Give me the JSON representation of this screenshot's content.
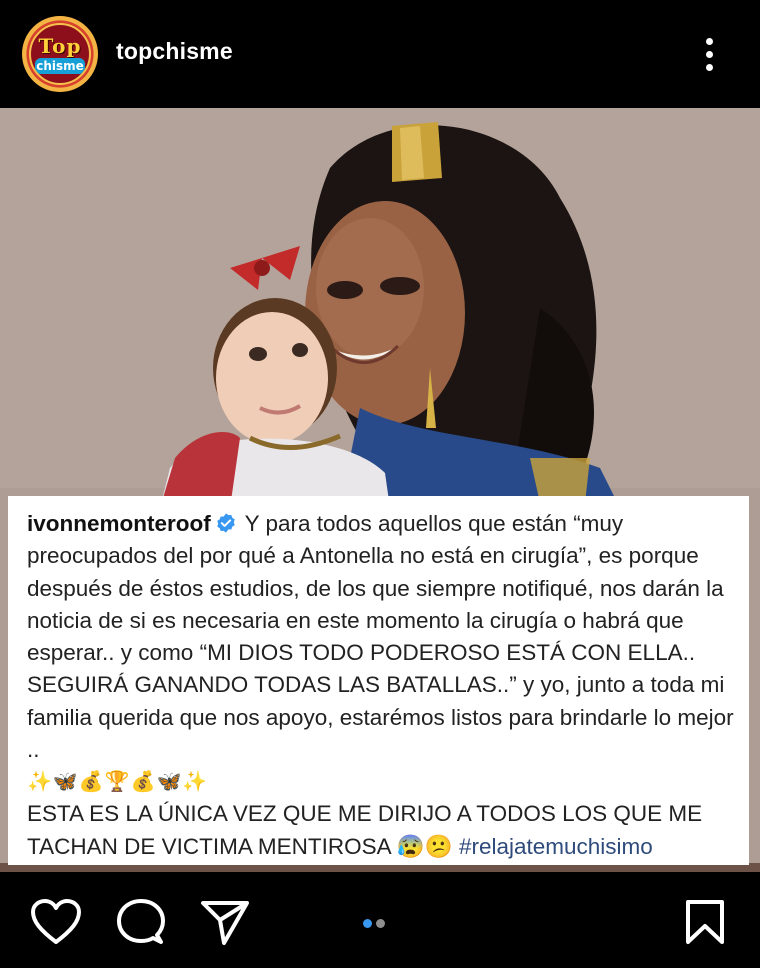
{
  "header": {
    "logo": {
      "top": "Top",
      "bottom": "chisme"
    },
    "username": "topchisme"
  },
  "caption": {
    "username": "ivonnemonteroof",
    "text": "Y para todos aquellos que están “muy preocupados del por qué a Antonella no está en cirugía”, es porque después de éstos estudios, de los que siempre notifiqué, nos darán la noticia de si es necesaria en este momento la cirugía o habrá que esperar.. y como “MI DIOS TODO PODEROSO ESTÁ CON ELLA.. SEGUIRÁ GANANDO TODAS LAS BATALLAS..” y yo, junto a toda mi familia querida que nos apoyo, estarémos listos para brindarle lo mejor ..",
    "emoji_line": "✨🦋💰🏆💰🦋✨",
    "closing_text": "ESTA ES LA ÚNICA VEZ QUE ME DIRIJO A TODOS LOS QUE ME TACHAN DE VICTIMA MENTIROSA",
    "closing_emoji": "😰😕",
    "hashtag": "#relajatemuchisimo"
  },
  "actions": {
    "icons": [
      "heart-icon",
      "comment-icon",
      "share-icon",
      "bookmark-icon"
    ],
    "carousel": {
      "pages": 2,
      "current": 1
    }
  },
  "colors": {
    "background": "#000000",
    "carousel_active": "#3897f0",
    "carousel_inactive": "#8e8e8e",
    "verified": "#3897f0"
  }
}
